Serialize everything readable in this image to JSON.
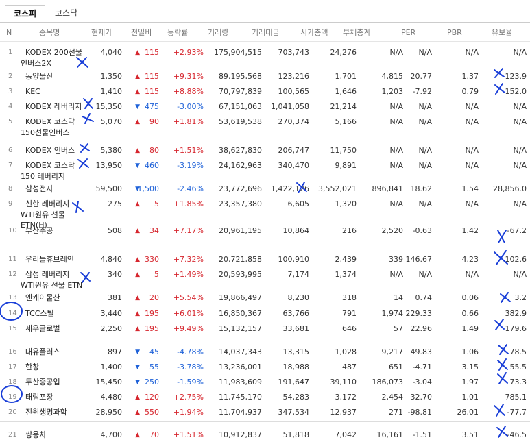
{
  "tabs": [
    {
      "label": "코스피",
      "active": true
    },
    {
      "label": "코스닥",
      "active": false
    }
  ],
  "columns": [
    "N",
    "종목명",
    "현재가",
    "전일비",
    "등락률",
    "거래량",
    "거래대금",
    "시가총액",
    "부채총계",
    "PER",
    "PBR",
    "유보율"
  ],
  "rows": [
    {
      "n": "1",
      "name": "KODEX 200선물",
      "name2": "인버스2X",
      "price": "4,040",
      "dir": "up",
      "diff": "115",
      "rate": "+2.93%",
      "vol": "175,904,515",
      "amt": "703,743",
      "cap": "24,276",
      "debt": "N/A",
      "per": "N/A",
      "pbr": "N/A",
      "reserve": "N/A"
    },
    {
      "n": "2",
      "name": "동양물산",
      "name2": "",
      "price": "1,350",
      "dir": "up",
      "diff": "115",
      "rate": "+9.31%",
      "vol": "89,195,568",
      "amt": "123,216",
      "cap": "1,701",
      "debt": "4,815",
      "per": "20.77",
      "pbr": "1.37",
      "reserve": "123.9"
    },
    {
      "n": "3",
      "name": "KEC",
      "name2": "",
      "price": "1,410",
      "dir": "up",
      "diff": "115",
      "rate": "+8.88%",
      "vol": "70,797,839",
      "amt": "100,565",
      "cap": "1,646",
      "debt": "1,203",
      "per": "-7.92",
      "pbr": "0.79",
      "reserve": "152.0"
    },
    {
      "n": "4",
      "name": "KODEX 레버리지",
      "name2": "",
      "price": "15,350",
      "dir": "down",
      "diff": "475",
      "rate": "-3.00%",
      "vol": "67,151,063",
      "amt": "1,041,058",
      "cap": "21,214",
      "debt": "N/A",
      "per": "N/A",
      "pbr": "N/A",
      "reserve": "N/A"
    },
    {
      "n": "5",
      "name": "KODEX 코스닥",
      "name2": "150선물인버스",
      "price": "5,070",
      "dir": "up",
      "diff": "90",
      "rate": "+1.81%",
      "vol": "53,619,538",
      "amt": "270,374",
      "cap": "5,166",
      "debt": "N/A",
      "per": "N/A",
      "pbr": "N/A",
      "reserve": "N/A"
    },
    {
      "n": "6",
      "name": "KODEX 인버스",
      "name2": "",
      "price": "5,380",
      "dir": "up",
      "diff": "80",
      "rate": "+1.51%",
      "vol": "38,627,830",
      "amt": "206,747",
      "cap": "11,750",
      "debt": "N/A",
      "per": "N/A",
      "pbr": "N/A",
      "reserve": "N/A"
    },
    {
      "n": "7",
      "name": "KODEX 코스닥",
      "name2": "150 레버리지",
      "price": "13,950",
      "dir": "down",
      "diff": "460",
      "rate": "-3.19%",
      "vol": "24,162,963",
      "amt": "340,470",
      "cap": "9,891",
      "debt": "N/A",
      "per": "N/A",
      "pbr": "N/A",
      "reserve": "N/A"
    },
    {
      "n": "8",
      "name": "삼성전자",
      "name2": "",
      "price": "59,500",
      "dir": "down",
      "diff": "1,500",
      "rate": "-2.46%",
      "vol": "23,772,696",
      "amt": "1,422,126",
      "cap": "3,552,021",
      "debt": "896,841",
      "per": "18.62",
      "pbr": "1.54",
      "reserve": "28,856.0"
    },
    {
      "n": "9",
      "name": "신한 레버리지",
      "name2": "WTI원유 선물",
      "name3": "ETN(H)",
      "price": "275",
      "dir": "up",
      "diff": "5",
      "rate": "+1.85%",
      "vol": "23,357,380",
      "amt": "6,605",
      "cap": "1,320",
      "debt": "N/A",
      "per": "N/A",
      "pbr": "N/A",
      "reserve": "N/A"
    },
    {
      "n": "10",
      "name": "부산주공",
      "name2": "",
      "price": "508",
      "dir": "up",
      "diff": "34",
      "rate": "+7.17%",
      "vol": "20,961,195",
      "amt": "10,864",
      "cap": "216",
      "debt": "2,520",
      "per": "-0.63",
      "pbr": "1.42",
      "reserve": "-67.2"
    },
    {
      "n": "11",
      "name": "우리들휴브레인",
      "name2": "",
      "price": "4,840",
      "dir": "up",
      "diff": "330",
      "rate": "+7.32%",
      "vol": "20,721,858",
      "amt": "100,910",
      "cap": "2,439",
      "debt": "339",
      "per": "146.67",
      "pbr": "4.23",
      "reserve": "102.6"
    },
    {
      "n": "12",
      "name": "삼성 레버리지",
      "name2": "WTI원유 선물 ETN",
      "price": "340",
      "dir": "up",
      "diff": "5",
      "rate": "+1.49%",
      "vol": "20,593,995",
      "amt": "7,174",
      "cap": "1,374",
      "debt": "N/A",
      "per": "N/A",
      "pbr": "N/A",
      "reserve": "N/A"
    },
    {
      "n": "13",
      "name": "엔케이물산",
      "name2": "",
      "price": "381",
      "dir": "up",
      "diff": "20",
      "rate": "+5.54%",
      "vol": "19,866,497",
      "amt": "8,230",
      "cap": "318",
      "debt": "14",
      "per": "0.74",
      "pbr": "0.06",
      "reserve": "3.2"
    },
    {
      "n": "14",
      "name": "TCC스틸",
      "name2": "",
      "price": "3,440",
      "dir": "up",
      "diff": "195",
      "rate": "+6.01%",
      "vol": "16,850,367",
      "amt": "63,766",
      "cap": "791",
      "debt": "1,974",
      "per": "229.33",
      "pbr": "0.66",
      "reserve": "382.9"
    },
    {
      "n": "15",
      "name": "세우글로벌",
      "name2": "",
      "price": "2,250",
      "dir": "up",
      "diff": "195",
      "rate": "+9.49%",
      "vol": "15,132,157",
      "amt": "33,681",
      "cap": "646",
      "debt": "57",
      "per": "22.96",
      "pbr": "1.49",
      "reserve": "179.6"
    },
    {
      "n": "16",
      "name": "대유플러스",
      "name2": "",
      "price": "897",
      "dir": "down",
      "diff": "45",
      "rate": "-4.78%",
      "vol": "14,037,343",
      "amt": "13,315",
      "cap": "1,028",
      "debt": "9,217",
      "per": "49.83",
      "pbr": "1.06",
      "reserve": "78.5"
    },
    {
      "n": "17",
      "name": "한창",
      "name2": "",
      "price": "1,400",
      "dir": "down",
      "diff": "55",
      "rate": "-3.78%",
      "vol": "13,236,001",
      "amt": "18,988",
      "cap": "487",
      "debt": "651",
      "per": "-4.71",
      "pbr": "3.15",
      "reserve": "55.5"
    },
    {
      "n": "18",
      "name": "두산중공업",
      "name2": "",
      "price": "15,450",
      "dir": "down",
      "diff": "250",
      "rate": "-1.59%",
      "vol": "11,983,609",
      "amt": "191,647",
      "cap": "39,110",
      "debt": "186,073",
      "per": "-3.04",
      "pbr": "1.97",
      "reserve": "73.3"
    },
    {
      "n": "19",
      "name": "태림포장",
      "name2": "",
      "price": "4,480",
      "dir": "up",
      "diff": "120",
      "rate": "+2.75%",
      "vol": "11,745,170",
      "amt": "54,283",
      "cap": "3,172",
      "debt": "2,454",
      "per": "32.70",
      "pbr": "1.01",
      "reserve": "785.1"
    },
    {
      "n": "20",
      "name": "진원생명과학",
      "name2": "",
      "price": "28,950",
      "dir": "up",
      "diff": "550",
      "rate": "+1.94%",
      "vol": "11,704,937",
      "amt": "347,534",
      "cap": "12,937",
      "debt": "271",
      "per": "-98.81",
      "pbr": "26.01",
      "reserve": "-77.7"
    },
    {
      "n": "21",
      "name": "쌍용차",
      "name2": "",
      "price": "4,700",
      "dir": "up",
      "diff": "70",
      "rate": "+1.51%",
      "vol": "10,912,837",
      "amt": "51,818",
      "cap": "7,042",
      "debt": "16,161",
      "per": "-1.51",
      "pbr": "3.51",
      "reserve": "-46.5"
    }
  ],
  "colors": {
    "up": "#d6262e",
    "down": "#1f62d8",
    "pen": "#1a3fd8"
  }
}
